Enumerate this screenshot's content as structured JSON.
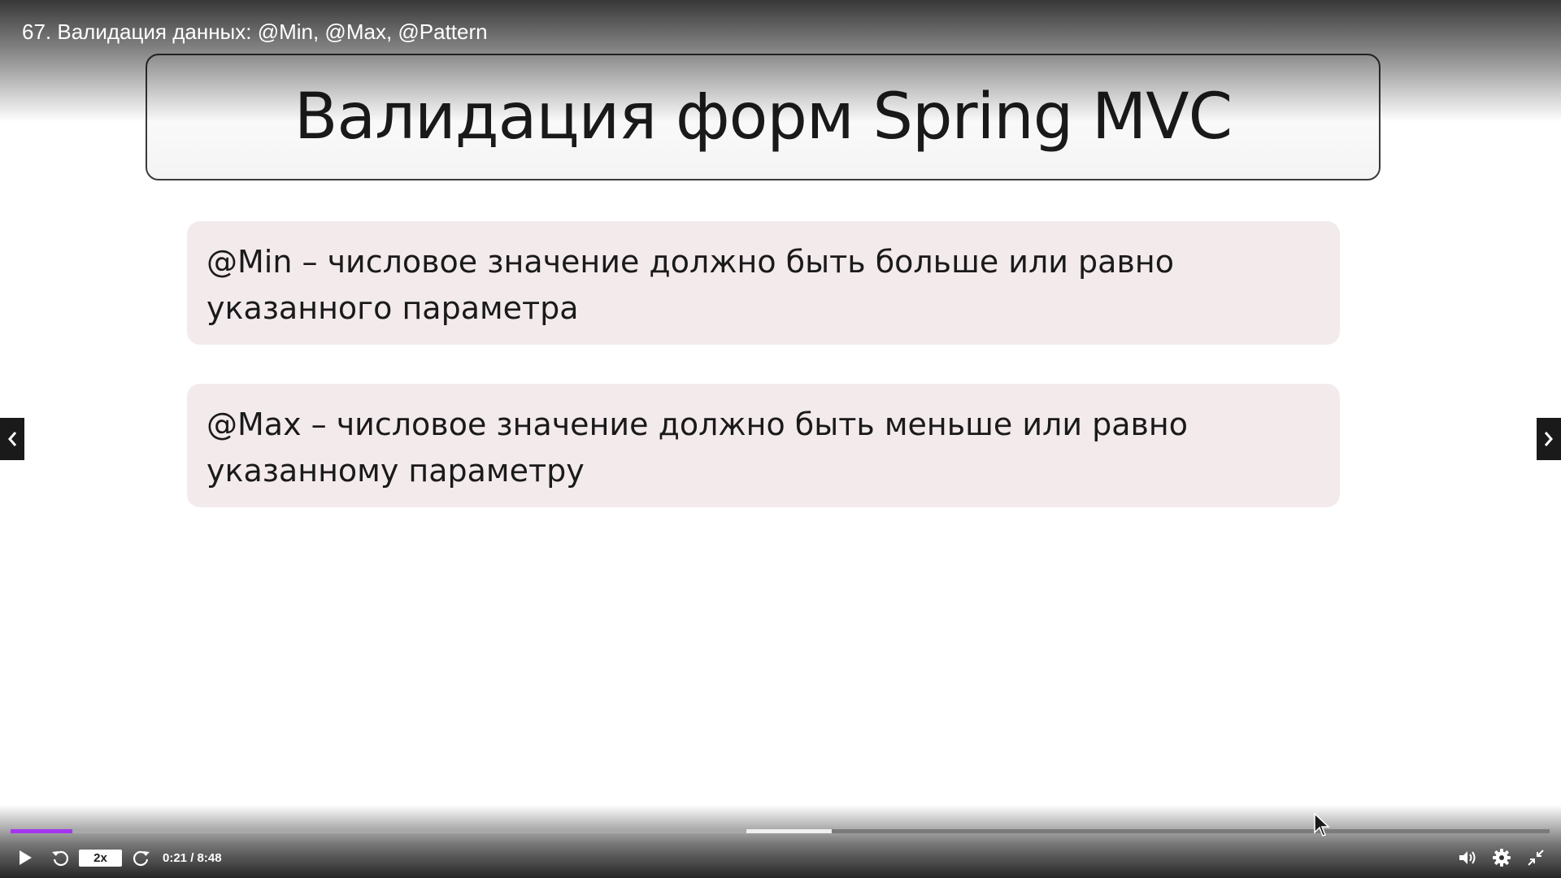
{
  "player": {
    "lecture_title": "67. Валидация данных: @Min, @Max, @Pattern"
  },
  "slide": {
    "title": "Валидация форм Spring MVC",
    "items": [
      {
        "text": "@Min – числовое значение должно быть больше или равно указанного параметра"
      },
      {
        "text": "@Max – числовое значение должно быть меньше или равно указанному параметру"
      }
    ]
  },
  "controls": {
    "speed_label": "2x",
    "time_label": "0:21 / 8:48",
    "progress_fraction": 0.04,
    "icons": {
      "play": "play-icon",
      "rewind": "rewind-icon",
      "forward": "forward-icon",
      "volume": "volume-icon",
      "settings": "gear-icon",
      "fullscreen": "exit-fullscreen-icon",
      "prev": "chevron-left-icon",
      "next": "chevron-right-icon"
    }
  },
  "colors": {
    "progress_played": "#a435f0",
    "box_background": "#f3eaec"
  }
}
